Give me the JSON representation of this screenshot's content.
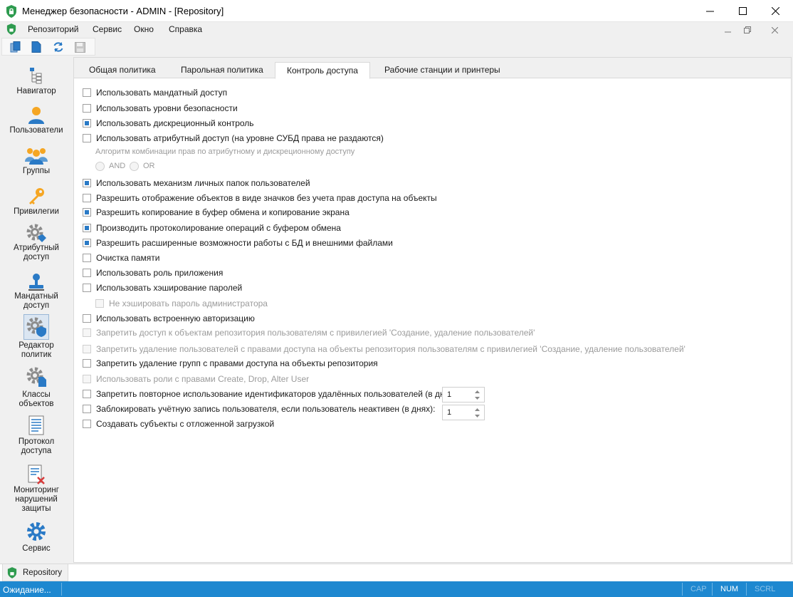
{
  "window": {
    "title": "Менеджер безопасности - ADMIN - [Repository]",
    "minimize_glyph": "—",
    "maximize_glyph": "☐",
    "close_glyph": "✕"
  },
  "menu": {
    "items": [
      "Репозиторий",
      "Сервис",
      "Окно",
      "Справка"
    ]
  },
  "toolbar": {
    "icons": [
      "copy-icon",
      "document-icon",
      "refresh-icon",
      "save-icon"
    ]
  },
  "nav": {
    "items": [
      {
        "label": "Навигатор",
        "icon": "navigator-icon"
      },
      {
        "label": "Пользователи",
        "icon": "user-icon"
      },
      {
        "label": "Группы",
        "icon": "group-icon"
      },
      {
        "label": "Привилегии",
        "icon": "key-icon"
      },
      {
        "label": "Атрибутный\nдоступ",
        "icon": "attribute-gear-icon"
      },
      {
        "label": "Мандатный\nдоступ",
        "icon": "stamp-icon"
      },
      {
        "label": "Редактор\nполитик",
        "icon": "policy-gear-icon"
      },
      {
        "label": "Классы\nобъектов",
        "icon": "class-gear-icon"
      },
      {
        "label": "Протокол\nдоступа",
        "icon": "log-icon"
      },
      {
        "label": "Мониторинг\nнарушений\nзащиты",
        "icon": "violation-icon"
      },
      {
        "label": "Сервис",
        "icon": "service-gear-icon"
      }
    ],
    "active_index": 6
  },
  "tabs": [
    "Общая политика",
    "Парольная политика",
    "Контроль доступа",
    "Рабочие станции и принтеры"
  ],
  "active_tab": 2,
  "options": [
    {
      "label": "Использовать мандатный доступ",
      "checked": false,
      "disabled": false
    },
    {
      "label": "Использовать уровни безопасности",
      "checked": false,
      "disabled": false
    },
    {
      "label": "Использовать дискреционный контроль",
      "checked": true,
      "disabled": false
    },
    {
      "label": "Использовать атрибутный доступ (на уровне СУБД права не раздаются)",
      "checked": false,
      "disabled": false
    },
    {
      "label": "Использовать механизм личных папок пользователей",
      "checked": true,
      "disabled": false
    },
    {
      "label": "Разрешить отображение объектов в виде значков без учета прав доступа на объекты",
      "checked": false,
      "disabled": false
    },
    {
      "label": "Разрешить копирование в буфер обмена и копирование экрана",
      "checked": true,
      "disabled": false
    },
    {
      "label": "Производить протоколирование операций с буфером обмена",
      "checked": true,
      "disabled": false
    },
    {
      "label": "Разрешить расширенные возможности работы с БД и внешними файлами",
      "checked": true,
      "disabled": false
    },
    {
      "label": "Очистка памяти",
      "checked": false,
      "disabled": false
    },
    {
      "label": "Использовать роль приложения",
      "checked": false,
      "disabled": false
    },
    {
      "label": "Использовать хэширование паролей",
      "checked": false,
      "disabled": false
    },
    {
      "label": "Не хэшировать пароль администратора",
      "checked": false,
      "disabled": true
    },
    {
      "label": "Использовать встроенную авторизацию",
      "checked": false,
      "disabled": false
    },
    {
      "label": "Запретить доступ к объектам репозитория пользователям с привилегией 'Создание, удаление пользователей'",
      "checked": false,
      "disabled": true
    },
    {
      "label": "Запретить удаление пользователей с правами доступа на объекты репозитория пользователям с привилегией 'Создание, удаление пользователей'",
      "checked": false,
      "disabled": true
    },
    {
      "label": "Запретить удаление групп с правами доступа на объекты репозитория",
      "checked": false,
      "disabled": false
    },
    {
      "label": "Использовать роли с правами Create, Drop, Alter User",
      "checked": false,
      "disabled": true
    },
    {
      "label": "Запретить повторное использование идентификаторов удалённых пользователей (в днях):",
      "checked": false,
      "disabled": false
    },
    {
      "label": "Заблокировать учётную запись пользователя, если пользователь неактивен (в днях):",
      "checked": false,
      "disabled": false
    },
    {
      "label": "Создавать субъекты с отложенной загрузкой",
      "checked": false,
      "disabled": false
    }
  ],
  "combo": {
    "caption": "Алгоритм комбинации прав по атрибутному и дискреционному доступу",
    "and_label": "AND",
    "or_label": "OR"
  },
  "spinners": {
    "reuse_days": "1",
    "lock_days": "1"
  },
  "doc_tab": {
    "label": "Repository"
  },
  "status": {
    "text": "Ожидание...",
    "cap": "CAP",
    "num": "NUM",
    "scrl": "SCRL"
  },
  "colors": {
    "accent": "#1e88d0",
    "check": "#2a7ac6",
    "shield": "#2e9b4f"
  }
}
